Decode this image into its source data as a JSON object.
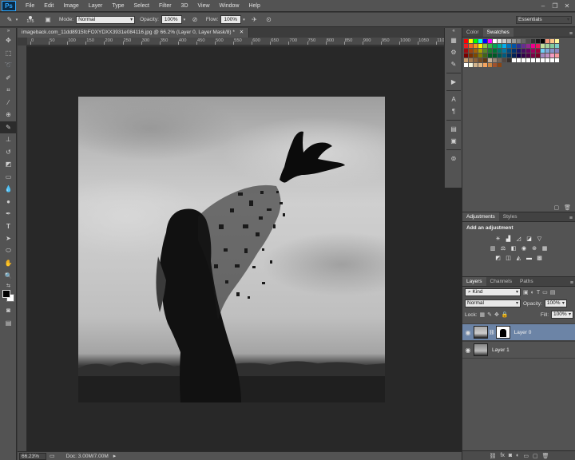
{
  "app": {
    "logo": "Ps"
  },
  "menu": [
    "File",
    "Edit",
    "Image",
    "Layer",
    "Type",
    "Select",
    "Filter",
    "3D",
    "View",
    "Window",
    "Help"
  ],
  "options": {
    "brush_size": "175",
    "mode_label": "Mode:",
    "mode_value": "Normal",
    "opacity_label": "Opacity:",
    "opacity_value": "100%",
    "flow_label": "Flow:",
    "flow_value": "100%",
    "workspace": "Essentials"
  },
  "document": {
    "tab_title": "imageback.com_11dd8915fcFOXYDXX3931e084116.jpg @ 66.2% (Layer 0, Layer Mask/8) *",
    "ruler_labels": [
      "0",
      "50",
      "100",
      "150",
      "200",
      "250",
      "300",
      "350",
      "400",
      "450",
      "500",
      "550",
      "600",
      "650",
      "700",
      "750",
      "800",
      "850",
      "900",
      "950",
      "1000",
      "1050",
      "1100",
      "1150"
    ]
  },
  "status": {
    "zoom": "66.23%",
    "doc": "Doc: 3.00M/7.00M"
  },
  "panels": {
    "color_tabs": [
      "Color",
      "Swatches"
    ],
    "adjust_tabs": [
      "Adjustments",
      "Styles"
    ],
    "adjust_title": "Add an adjustment",
    "layer_tabs": [
      "Layers",
      "Channels",
      "Paths"
    ],
    "kind_label": "Kind",
    "blend_mode": "Normal",
    "opacity_label": "Opacity:",
    "opacity_value": "100%",
    "lock_label": "Lock:",
    "fill_label": "Fill:",
    "fill_value": "100%",
    "layers": [
      {
        "name": "Layer 0",
        "selected": true
      },
      {
        "name": "Layer 1",
        "selected": false
      }
    ]
  },
  "colors": {
    "accent_selection": "#6c84a6",
    "chrome": "#535353",
    "canvas_bg": "#282828"
  }
}
